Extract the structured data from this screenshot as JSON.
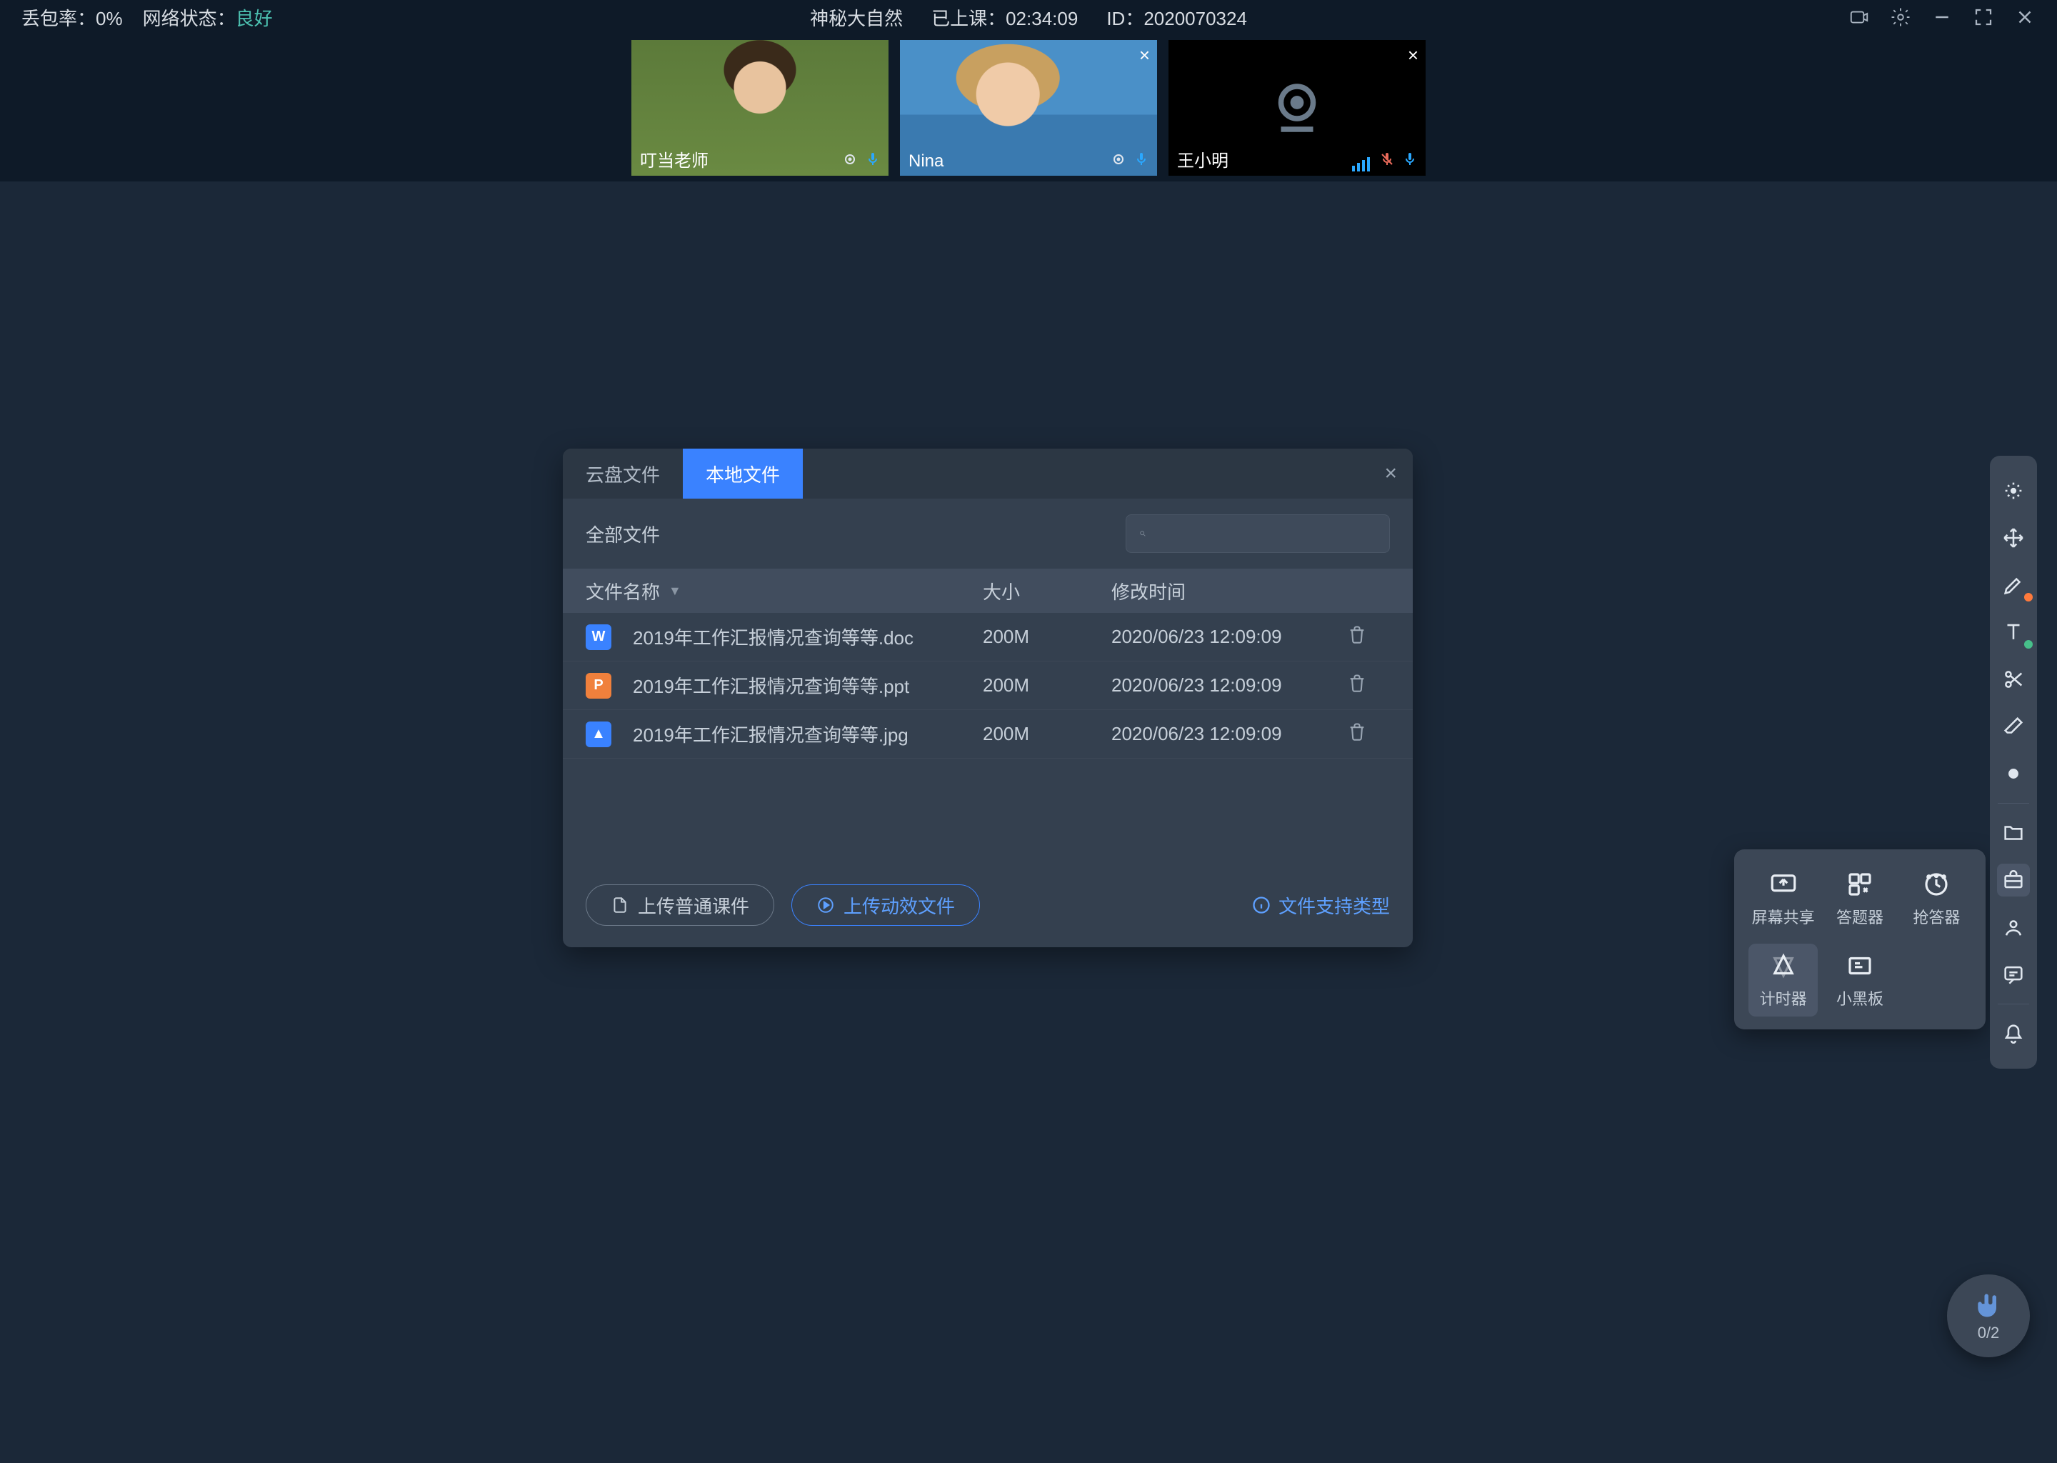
{
  "topbar": {
    "packet_loss_label": "丢包率：",
    "packet_loss_value": "0%",
    "network_label": "网络状态：",
    "network_value": "良好",
    "course_name": "神秘大自然",
    "elapsed_label": "已上课：",
    "elapsed_value": "02:34:09",
    "id_label": "ID：",
    "id_value": "2020070324"
  },
  "participants": [
    {
      "name": "叮当老师",
      "camera_on": true,
      "muted": false,
      "closable": false
    },
    {
      "name": "Nina",
      "camera_on": true,
      "muted": false,
      "closable": true
    },
    {
      "name": "王小明",
      "camera_on": false,
      "muted": true,
      "closable": true
    }
  ],
  "dialog": {
    "tabs": [
      "云盘文件",
      "本地文件"
    ],
    "active_tab": 1,
    "all_files_label": "全部文件",
    "search_placeholder": "",
    "columns": {
      "name": "文件名称",
      "size": "大小",
      "date": "修改时间"
    },
    "rows": [
      {
        "icon": "doc",
        "icon_text": "W",
        "name": "2019年工作汇报情况查询等等.doc",
        "size": "200M",
        "date": "2020/06/23 12:09:09"
      },
      {
        "icon": "ppt",
        "icon_text": "P",
        "name": "2019年工作汇报情况查询等等.ppt",
        "size": "200M",
        "date": "2020/06/23 12:09:09"
      },
      {
        "icon": "jpg",
        "icon_text": "▲",
        "name": "2019年工作汇报情况查询等等.jpg",
        "size": "200M",
        "date": "2020/06/23 12:09:09"
      }
    ],
    "btn_upload_normal": "上传普通课件",
    "btn_upload_anim": "上传动效文件",
    "support_link": "文件支持类型"
  },
  "tool_popup": {
    "items": [
      {
        "id": "screen-share",
        "label": "屏幕共享"
      },
      {
        "id": "answer-machine",
        "label": "答题器"
      },
      {
        "id": "responder",
        "label": "抢答器"
      },
      {
        "id": "timer",
        "label": "计时器"
      },
      {
        "id": "blackboard",
        "label": "小黑板"
      }
    ],
    "active_id": "timer"
  },
  "sidebar": {
    "items": [
      "laser-pointer-icon",
      "move-icon",
      "pen-icon",
      "text-icon",
      "scissors-icon",
      "eraser-icon",
      "color-picker-icon",
      "folder-icon",
      "toolbox-icon",
      "user-icon",
      "chat-icon",
      "bell-icon"
    ],
    "active_index": 8
  },
  "hand": {
    "count": "0/2"
  }
}
